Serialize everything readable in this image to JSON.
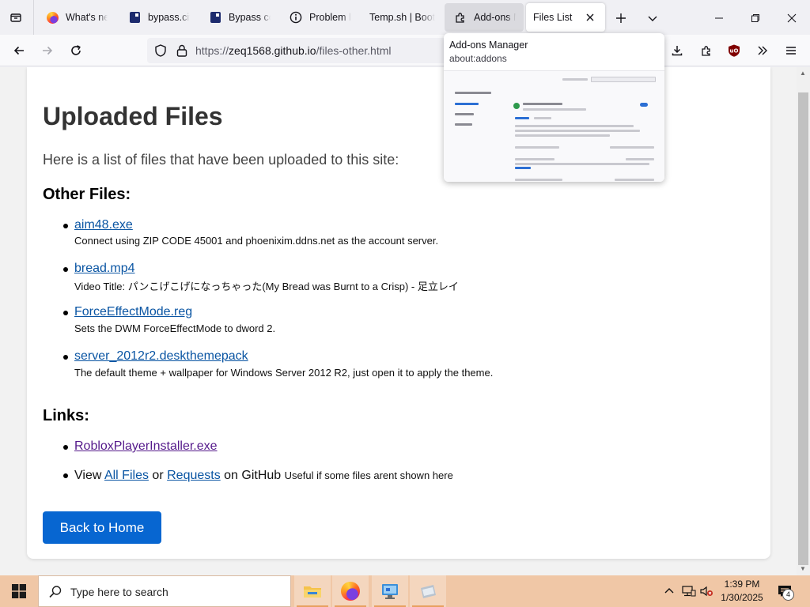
{
  "browser": {
    "tabs": [
      {
        "label": "What's new",
        "icon": "firefox-icon"
      },
      {
        "label": "bypass.city",
        "icon": "site-favicon-icon"
      },
      {
        "label": "Bypass con",
        "icon": "site-favicon-icon"
      },
      {
        "label": "Problem lo",
        "icon": "info-circle-icon"
      },
      {
        "label": "Temp.sh | Boots",
        "icon": "none"
      },
      {
        "label": "Add-ons M",
        "icon": "puzzle-icon"
      },
      {
        "label": "Files List",
        "icon": "none",
        "selected": true
      }
    ],
    "url": {
      "scheme": "https://",
      "host": "zeq1568.github.io",
      "path": "/files-other.html"
    },
    "preview": {
      "title": "Add-ons Manager",
      "url": "about:addons"
    }
  },
  "page": {
    "title": "Uploaded Files",
    "intro": "Here is a list of files that have been uploaded to this site:",
    "other_files_heading": "Other Files:",
    "files": [
      {
        "name": "aim48.exe",
        "desc": "Connect using ZIP CODE 45001 and phoenixim.ddns.net as the account server."
      },
      {
        "name": "bread.mp4",
        "desc": "Video Title: パンこげこげになっちゃった(My Bread was Burnt to a Crisp) - 足立レイ"
      },
      {
        "name": "ForceEffectMode.reg",
        "desc": "Sets the DWM ForceEffectMode to dword 2."
      },
      {
        "name": "server_2012r2.deskthemepack",
        "desc": "The default theme + wallpaper for Windows Server 2012 R2, just open it to apply the theme."
      }
    ],
    "links_heading": "Links:",
    "roblox_link": "RobloxPlayerInstaller.exe",
    "github_line": {
      "prefix": "View",
      "all_files": "All Files",
      "or": "or",
      "requests": "Requests",
      "suffix": "on GitHub",
      "note": "Useful if some files arent shown here"
    },
    "home_button": "Back to Home"
  },
  "taskbar": {
    "search_placeholder": "Type here to search",
    "time": "1:39 PM",
    "date": "1/30/2025",
    "notification_count": "4"
  },
  "colors": {
    "link": "#0a55a3",
    "visited": "#551a8b",
    "button": "#0766d1",
    "taskbar": "#f0c7a6"
  }
}
